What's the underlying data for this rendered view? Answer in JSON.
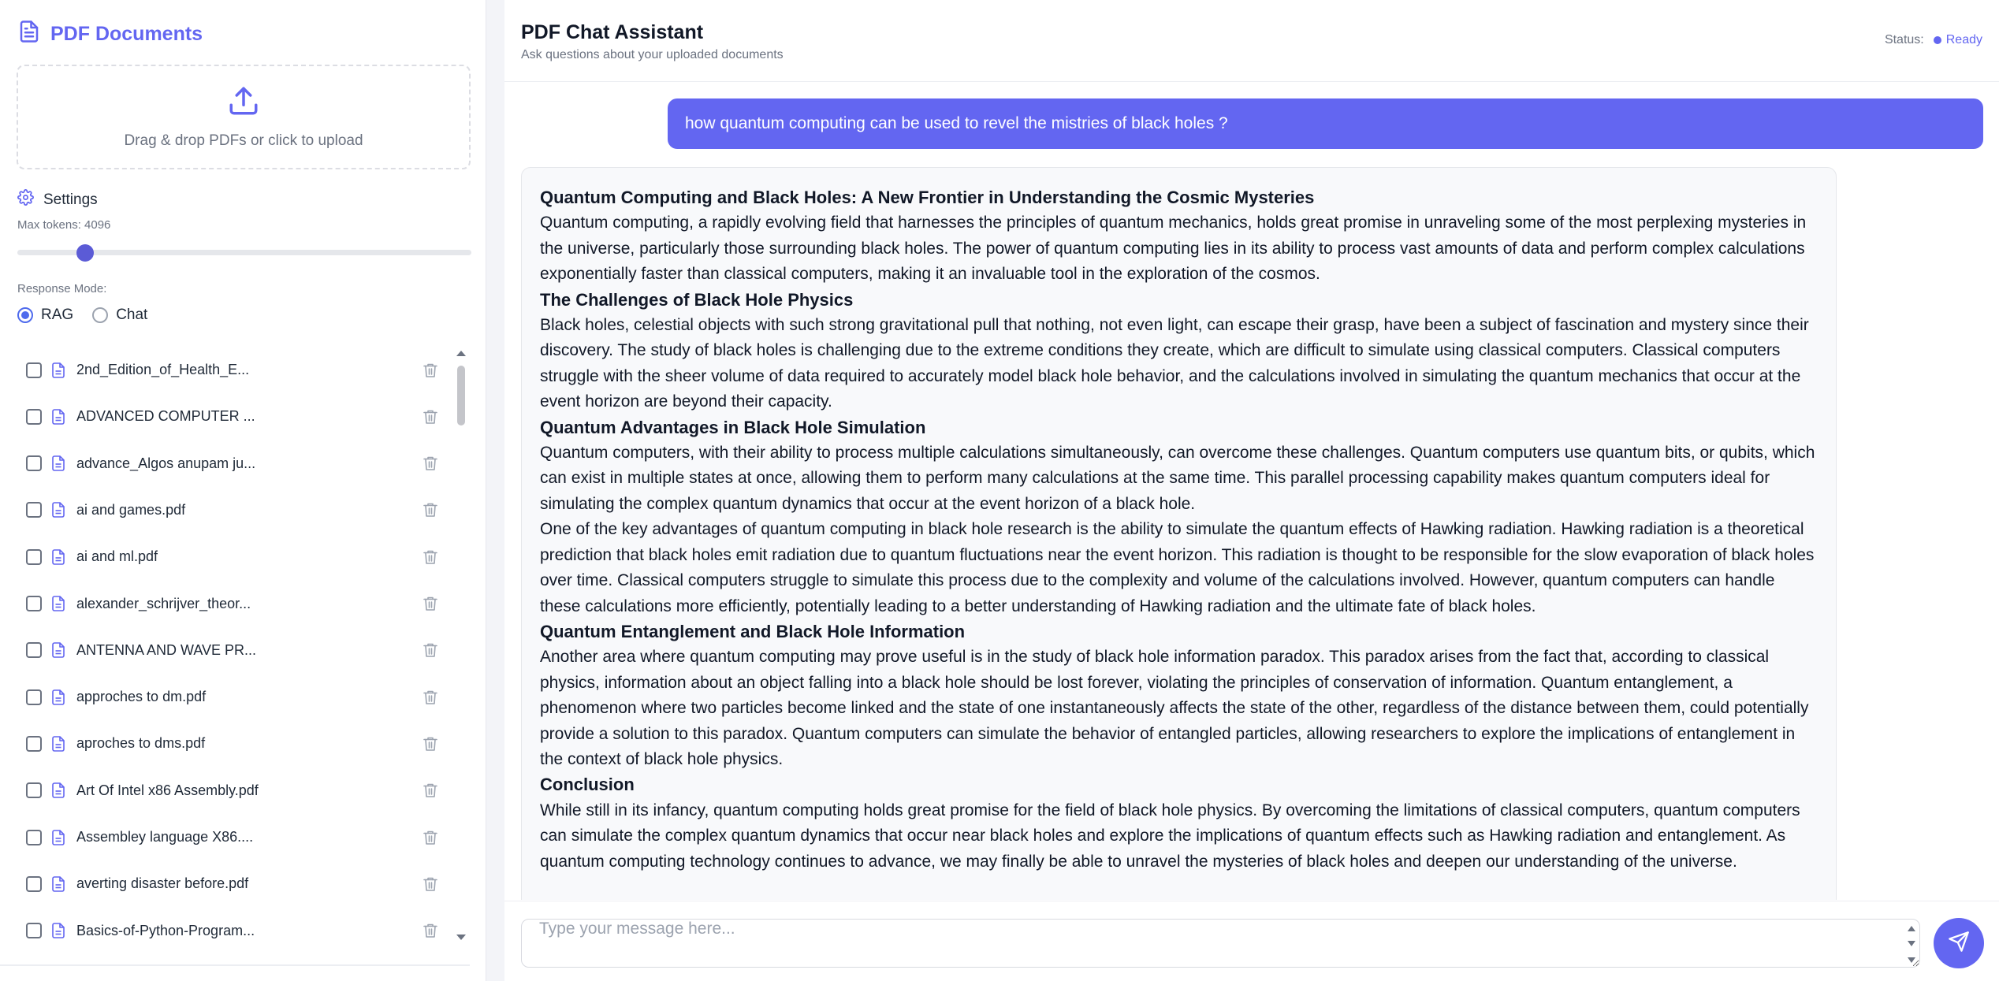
{
  "sidebar": {
    "title": "PDF Documents",
    "upload_text": "Drag & drop PDFs or click to upload",
    "settings_label": "Settings",
    "max_tokens_label": "Max tokens: 4096",
    "max_tokens_fraction": 0.15,
    "response_mode_label": "Response Mode:",
    "modes": [
      {
        "label": "RAG",
        "selected": true
      },
      {
        "label": "Chat",
        "selected": false
      }
    ],
    "files": [
      "2nd_Edition_of_Health_E...",
      "ADVANCED COMPUTER ...",
      "advance_Algos anupam ju...",
      "ai and games.pdf",
      "ai and ml.pdf",
      "alexander_schrijver_theor...",
      "ANTENNA AND WAVE PR...",
      "approches to dm.pdf",
      "aproches to dms.pdf",
      "Art Of Intel x86 Assembly.pdf",
      "Assembley language X86....",
      "averting disaster before.pdf",
      "Basics-of-Python-Program..."
    ]
  },
  "header": {
    "title": "PDF Chat Assistant",
    "subtitle": "Ask questions about your uploaded documents",
    "status_label": "Status:",
    "status_value": "Ready"
  },
  "chat": {
    "user_message": "how quantum computing can be used to revel the mistries of black holes ?",
    "response": [
      {
        "type": "h",
        "text": "Quantum Computing and Black Holes: A New Frontier in Understanding the Cosmic Mysteries"
      },
      {
        "type": "p",
        "text": "Quantum computing, a rapidly evolving field that harnesses the principles of quantum mechanics, holds great promise in unraveling some of the most perplexing mysteries in the universe, particularly those surrounding black holes. The power of quantum computing lies in its ability to process vast amounts of data and perform complex calculations exponentially faster than classical computers, making it an invaluable tool in the exploration of the cosmos."
      },
      {
        "type": "h",
        "text": "The Challenges of Black Hole Physics"
      },
      {
        "type": "p",
        "text": "Black holes, celestial objects with such strong gravitational pull that nothing, not even light, can escape their grasp, have been a subject of fascination and mystery since their discovery. The study of black holes is challenging due to the extreme conditions they create, which are difficult to simulate using classical computers. Classical computers struggle with the sheer volume of data required to accurately model black hole behavior, and the calculations involved in simulating the quantum mechanics that occur at the event horizon are beyond their capacity."
      },
      {
        "type": "h",
        "text": "Quantum Advantages in Black Hole Simulation"
      },
      {
        "type": "p",
        "text": "Quantum computers, with their ability to process multiple calculations simultaneously, can overcome these challenges. Quantum computers use quantum bits, or qubits, which can exist in multiple states at once, allowing them to perform many calculations at the same time. This parallel processing capability makes quantum computers ideal for simulating the complex quantum dynamics that occur at the event horizon of a black hole."
      },
      {
        "type": "p",
        "text": "One of the key advantages of quantum computing in black hole research is the ability to simulate the quantum effects of Hawking radiation. Hawking radiation is a theoretical prediction that black holes emit radiation due to quantum fluctuations near the event horizon. This radiation is thought to be responsible for the slow evaporation of black holes over time. Classical computers struggle to simulate this process due to the complexity and volume of the calculations involved. However, quantum computers can handle these calculations more efficiently, potentially leading to a better understanding of Hawking radiation and the ultimate fate of black holes."
      },
      {
        "type": "h",
        "text": "Quantum Entanglement and Black Hole Information"
      },
      {
        "type": "p",
        "text": "Another area where quantum computing may prove useful is in the study of black hole information paradox. This paradox arises from the fact that, according to classical physics, information about an object falling into a black hole should be lost forever, violating the principles of conservation of information. Quantum entanglement, a phenomenon where two particles become linked and the state of one instantaneously affects the state of the other, regardless of the distance between them, could potentially provide a solution to this paradox. Quantum computers can simulate the behavior of entangled particles, allowing researchers to explore the implications of entanglement in the context of black hole physics."
      },
      {
        "type": "h",
        "text": "Conclusion"
      },
      {
        "type": "p",
        "text": "While still in its infancy, quantum computing holds great promise for the field of black hole physics. By overcoming the limitations of classical computers, quantum computers can simulate the complex quantum dynamics that occur near black holes and explore the implications of quantum effects such as Hawking radiation and entanglement. As quantum computing technology continues to advance, we may finally be able to unravel the mysteries of black holes and deepen our understanding of the universe."
      }
    ],
    "input_placeholder": "Type your message here..."
  },
  "colors": {
    "accent": "#6366f1",
    "radio": "#4f6bed"
  }
}
